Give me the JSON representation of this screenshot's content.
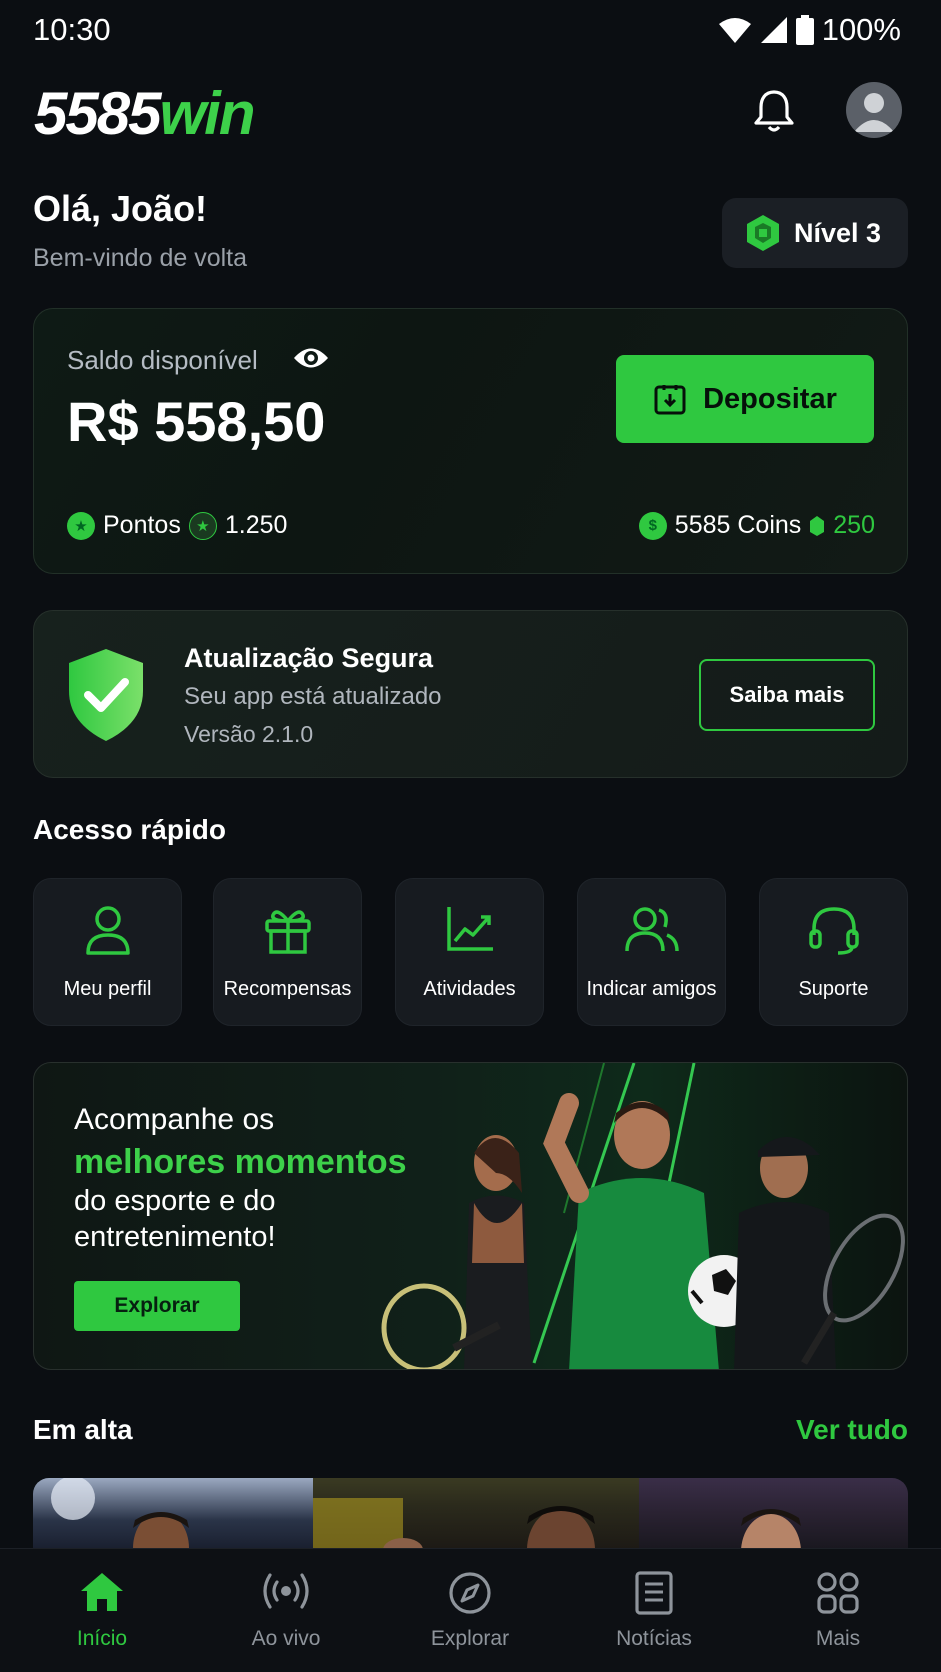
{
  "status_bar": {
    "time": "10:30",
    "battery": "100%"
  },
  "header": {
    "logo_prefix": "5585",
    "logo_suffix": "win",
    "bell_icon": "bell-icon",
    "avatar_icon": "user-avatar-icon"
  },
  "greeting": {
    "title": "Olá, João!",
    "subtitle": "Bem-vindo de volta",
    "level": "Nível 3"
  },
  "balance": {
    "label": "Saldo disponível",
    "value": "R$ 558,50",
    "deposit_label": "Depositar",
    "points_label": "Pontos",
    "points_value": "1.250",
    "coins_label": "5585 Coins",
    "coins_value": "250"
  },
  "update": {
    "title": "Atualização Segura",
    "subtitle": "Seu app está atualizado",
    "version": "Versão 2.1.0",
    "button": "Saiba mais"
  },
  "quick_access": {
    "title": "Acesso rápido",
    "items": [
      {
        "label": "Meu perfil",
        "icon": "user-icon"
      },
      {
        "label": "Recompensas",
        "icon": "gift-icon"
      },
      {
        "label": "Atividades",
        "icon": "chart-icon"
      },
      {
        "label": "Indicar amigos",
        "icon": "users-icon"
      },
      {
        "label": "Suporte",
        "icon": "headset-icon"
      }
    ]
  },
  "banner": {
    "line1": "Acompanhe os",
    "line2": "melhores momentos",
    "line3": "do esporte e do",
    "line4": "entretenimento!",
    "button": "Explorar"
  },
  "trending": {
    "title": "Em alta",
    "see_all": "Ver tudo"
  },
  "bottom_nav": {
    "items": [
      {
        "label": "Início",
        "icon": "home-icon",
        "active": true
      },
      {
        "label": "Ao vivo",
        "icon": "live-icon",
        "active": false
      },
      {
        "label": "Explorar",
        "icon": "compass-icon",
        "active": false
      },
      {
        "label": "Notícias",
        "icon": "news-icon",
        "active": false
      },
      {
        "label": "Mais",
        "icon": "grid-icon",
        "active": false
      }
    ]
  },
  "colors": {
    "accent": "#2fc840",
    "background": "#0b0e12",
    "card": "#171b20"
  }
}
